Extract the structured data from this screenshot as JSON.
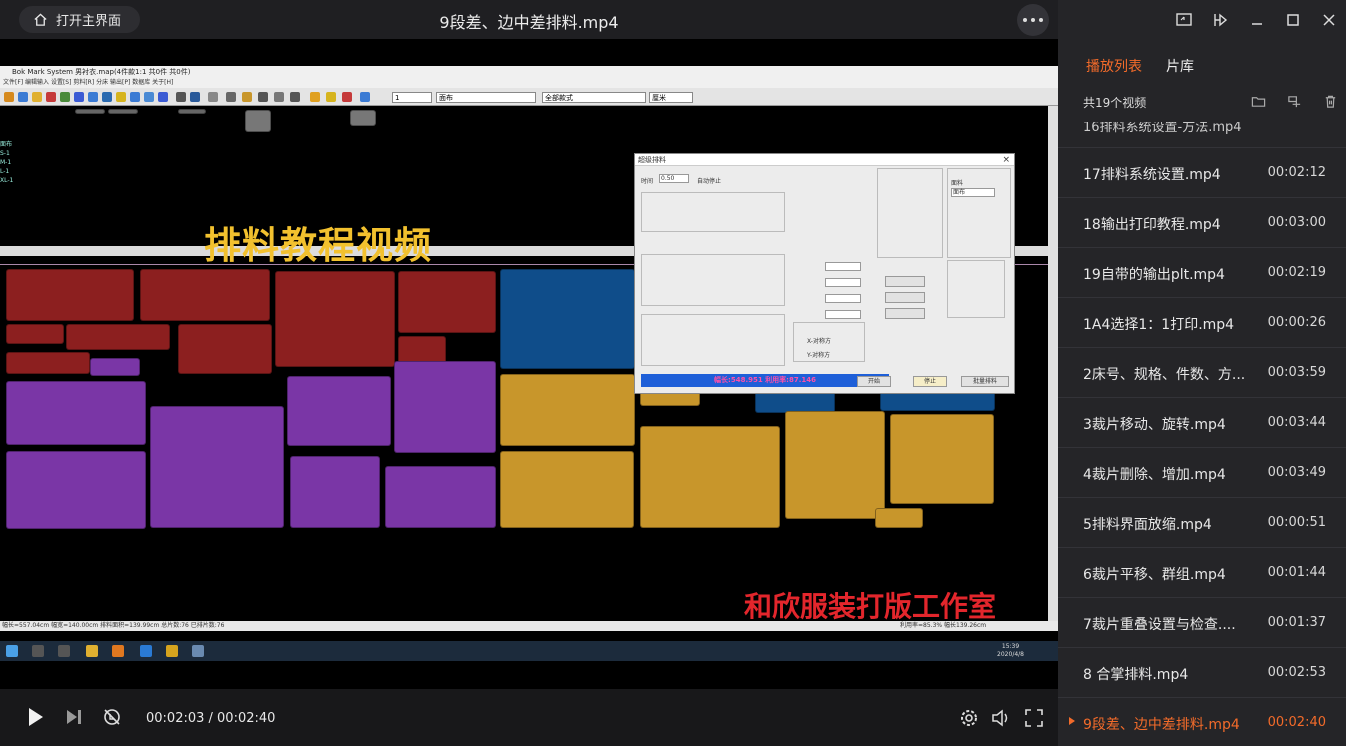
{
  "window": {
    "home_button": "打开主界面",
    "title": "9段差、边中差排料.mp4"
  },
  "video": {
    "software_title": "Bok Mark System      男衬衣.map(4件款1:1 共0件 共0件)",
    "menu": "文件[F]   编辑输入   设置[S]   剪料[R]   分床   输出[P]   数据库   关于[H]",
    "toolbar": {
      "select1": "1",
      "select2": "面布",
      "select3": "全部款式",
      "select4": "厘米"
    },
    "size_list": [
      "面布",
      "S-1",
      "M-1",
      "L-1",
      "XL-1"
    ],
    "status_text": "幅长=557.04cm 幅宽=140.00cm 排料面积=139.99cm 总片数:76 已排片数:76",
    "status_right": "利用率=85.3%     幅长139.26cm",
    "overlay_main": "排料教程视频",
    "overlay_studio": "和欣服装打版工作室",
    "taskbar_time": "15:39",
    "taskbar_date": "2020/4/8",
    "dialog": {
      "title": "超级排料",
      "time_label": "时间",
      "time_value": "0.50",
      "auto_stop": "自动停止",
      "progress": "幅长:548.951  利用率:87.146",
      "btn_start": "开始",
      "btn_stop": "停止",
      "btn_batch": "批量排料",
      "opt_x": "X-对称方",
      "opt_y": "Y-对称方",
      "fabric_label": "面料",
      "fabric_value": "面布"
    }
  },
  "controls": {
    "time_text": "00:02:03 / 00:02:40"
  },
  "sidebar": {
    "tabs": [
      "播放列表",
      "片库"
    ],
    "count": "共19个视频",
    "partial_item": "16排料系统设置-方法.mp4",
    "items": [
      {
        "name": "17排料系统设置.mp4",
        "duration": "00:02:12"
      },
      {
        "name": "18输出打印教程.mp4",
        "duration": "00:03:00"
      },
      {
        "name": "19自带的输出plt.mp4",
        "duration": "00:02:19"
      },
      {
        "name": "1A4选择1：1打印.mp4",
        "duration": "00:00:26"
      },
      {
        "name": "2床号、规格、件数、方...",
        "duration": "00:03:59"
      },
      {
        "name": "3裁片移动、旋转.mp4",
        "duration": "00:03:44"
      },
      {
        "name": "4裁片删除、增加.mp4",
        "duration": "00:03:49"
      },
      {
        "name": "5排料界面放缩.mp4",
        "duration": "00:00:51"
      },
      {
        "name": "6裁片平移、群组.mp4",
        "duration": "00:01:44"
      },
      {
        "name": "7裁片重叠设置与检查....",
        "duration": "00:01:37"
      },
      {
        "name": "8 合掌排料.mp4",
        "duration": "00:02:53"
      },
      {
        "name": "9段差、边中差排料.mp4",
        "duration": "00:02:40"
      }
    ]
  },
  "colors": {
    "accent": "#f36b2a",
    "overlay_yellow": "#f2c12e",
    "overlay_red": "#e3262c"
  }
}
